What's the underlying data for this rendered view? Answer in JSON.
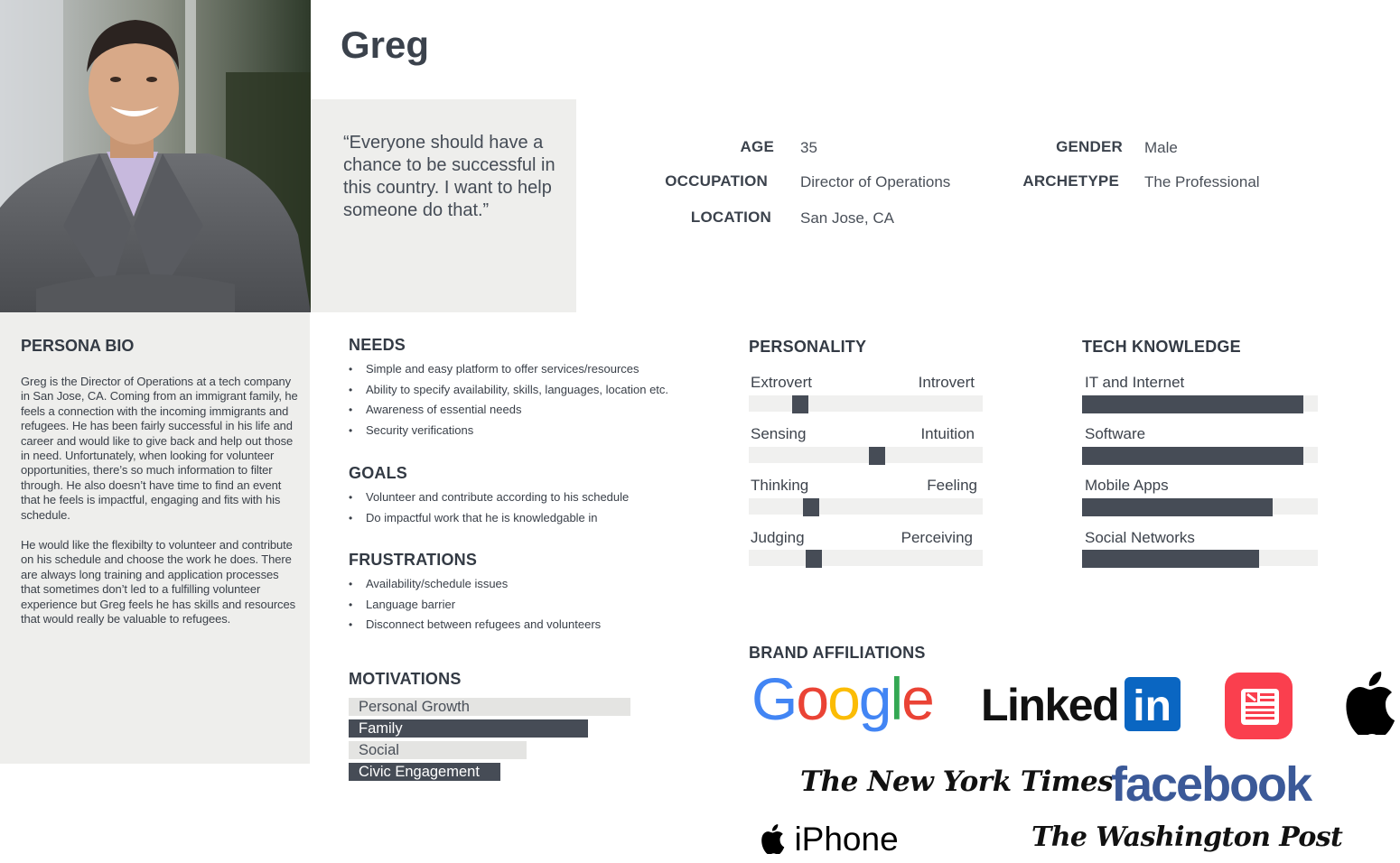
{
  "persona": {
    "name": "Greg",
    "quote": "“Everyone should have a chance to be successful in this country. I want to help someone do that.”"
  },
  "info": {
    "age_label": "AGE",
    "age": "35",
    "occupation_label": "OCCUPATION",
    "occupation": "Director of Operations",
    "location_label": "LOCATION",
    "location": "San Jose, CA",
    "gender_label": "GENDER",
    "gender": "Male",
    "archetype_label": "ARCHETYPE",
    "archetype": "The Professional"
  },
  "bio": {
    "title": "PERSONA BIO",
    "p1": "Greg is the Director of Operations at a tech company in San Jose, CA. Coming from an immigrant family, he feels a connection with the incoming immigrants and refugees. He has been fairly successful in his life and career and would like to give back and help out those in need. Unfortunately, when looking for volunteer opportunities, there’s so much information to filter through. He also doesn’t have time to find an event that he feels is impactful, engaging and fits with his schedule.",
    "p2": "He would like the flexibilty to volunteer and contribute on his schedule and choose the work he does. There are always long training and application processes that sometimes don’t led to a fulfilling volunteer experience but Greg feels he has skills and resources that would really be valuable to refugees."
  },
  "needs": {
    "title": "NEEDS",
    "items": [
      "Simple and easy platform to offer services/resources",
      "Ability to specify availability, skills, languages, location etc.",
      "Awareness of essential needs",
      "Security verifications"
    ]
  },
  "goals": {
    "title": "GOALS",
    "items": [
      "Volunteer and contribute according to his schedule",
      "Do impactful work that he is knowledgable in"
    ]
  },
  "frustrations": {
    "title": "FRUSTRATIONS",
    "items": [
      "Availability/schedule issues",
      "Language barrier",
      "Disconnect between refugees and volunteers"
    ]
  },
  "motivations": {
    "title": "MOTIVATIONS",
    "items": [
      {
        "label": "Personal Growth",
        "level": 1.0,
        "style": "light"
      },
      {
        "label": "Family",
        "level": 0.85,
        "style": "dark"
      },
      {
        "label": "Social",
        "level": 0.63,
        "style": "light"
      },
      {
        "label": "Civic Engagement",
        "level": 0.54,
        "style": "dark"
      }
    ]
  },
  "personality": {
    "title": "PERSONALITY",
    "traits": [
      {
        "left": "Extrovert",
        "right": "Introvert",
        "position": 0.2
      },
      {
        "left": "Sensing",
        "right": "Intuition",
        "position": 0.55
      },
      {
        "left": "Thinking",
        "right": "Feeling",
        "position": 0.25
      },
      {
        "left": "Judging",
        "right": "Perceiving",
        "position": 0.26
      }
    ]
  },
  "tech": {
    "title": "TECH KNOWLEDGE",
    "items": [
      {
        "label": "IT and Internet",
        "level": 0.94
      },
      {
        "label": "Software",
        "level": 0.94
      },
      {
        "label": "Mobile Apps",
        "level": 0.81
      },
      {
        "label": "Social Networks",
        "level": 0.75
      }
    ]
  },
  "brands": {
    "title": "BRAND AFFILIATIONS",
    "google": "Google",
    "linkedin_text": "Linked",
    "linkedin_in": "in",
    "nyt": "The New York Times",
    "facebook": "facebook",
    "iphone": "iPhone",
    "wapo": "The Washington Post",
    "colors": {
      "linkedin": "#0a66c2",
      "facebook": "#3b5998",
      "news": "#fa3f4e"
    }
  }
}
